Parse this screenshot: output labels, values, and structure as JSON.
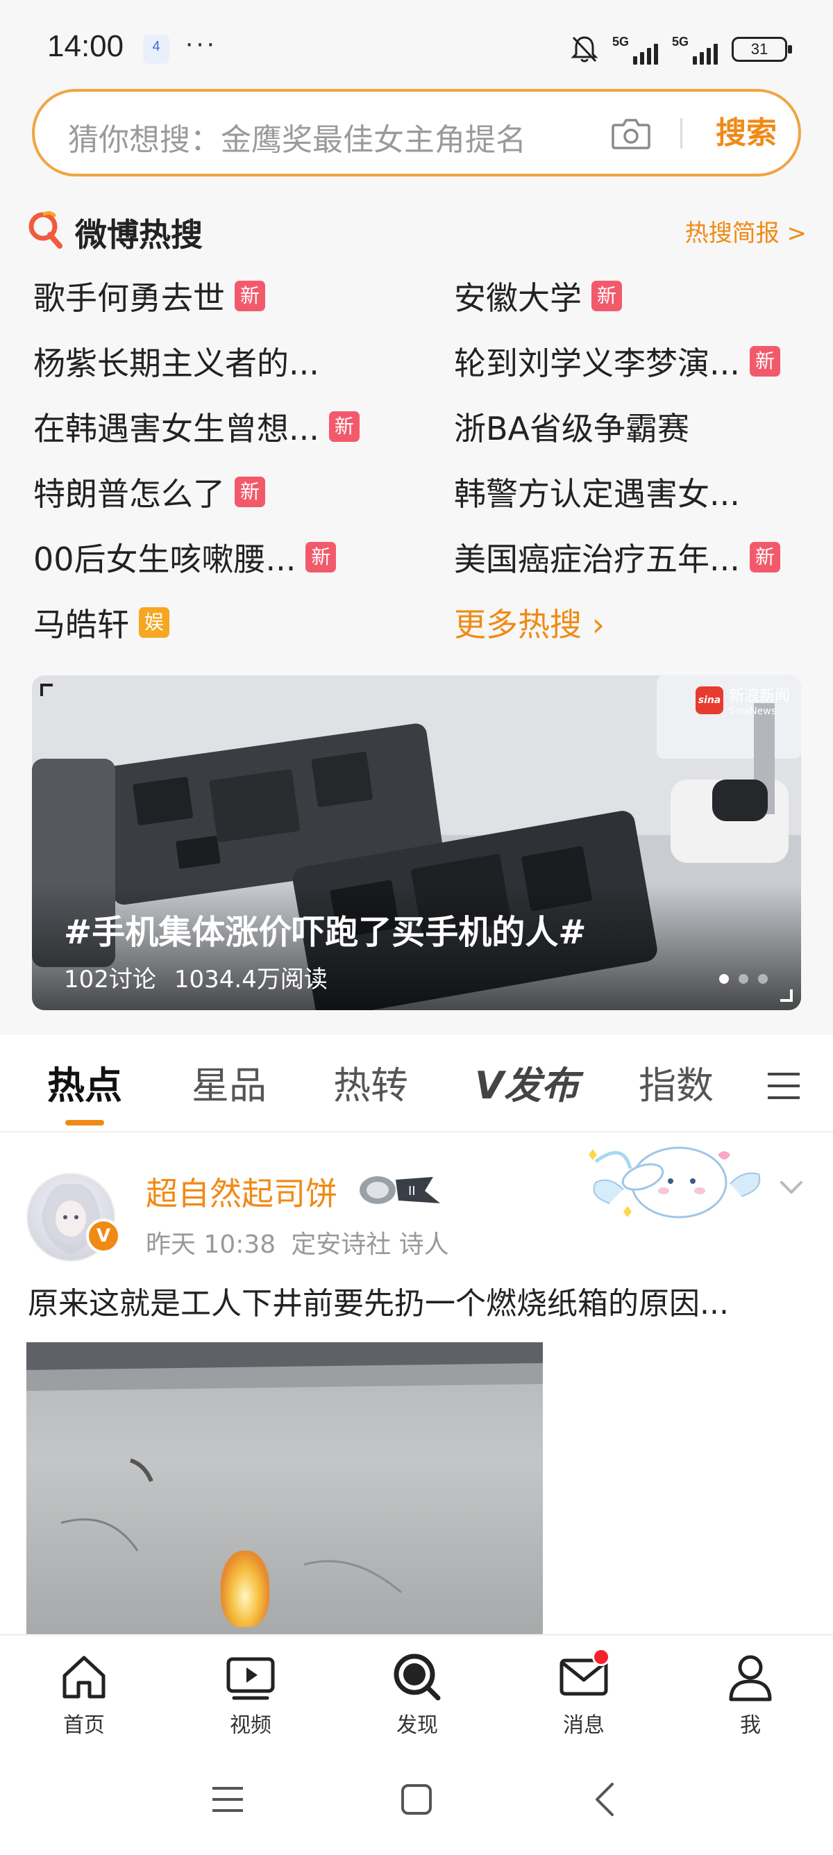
{
  "status_bar": {
    "time": "14:00",
    "notification_badge": "4",
    "more": "···",
    "network_1": "5G",
    "network_2": "5G",
    "battery": "31"
  },
  "search": {
    "placeholder": "猜你想搜：金鹰奖最佳女主角提名",
    "button_label": "搜索"
  },
  "hot_search": {
    "title": "微博热搜",
    "report_link": "热搜简报 >",
    "items": [
      {
        "text": "歌手何勇去世",
        "badge": "新"
      },
      {
        "text": "安徽大学",
        "badge": "新"
      },
      {
        "text": "杨紫长期主义者的...",
        "badge": ""
      },
      {
        "text": "轮到刘学义李梦演...",
        "badge": "新"
      },
      {
        "text": "在韩遇害女生曾想...",
        "badge": "新"
      },
      {
        "text": "浙BA省级争霸赛",
        "badge": ""
      },
      {
        "text": "特朗普怎么了",
        "badge": "新"
      },
      {
        "text": "韩警方认定遇害女...",
        "badge": ""
      },
      {
        "text": "00后女生咳嗽腰...",
        "badge": "新"
      },
      {
        "text": "美国癌症治疗五年...",
        "badge": "新"
      },
      {
        "text": "马皓轩",
        "badge": "娱"
      }
    ],
    "more_label": "更多热搜 ›"
  },
  "banner": {
    "title": "#手机集体涨价吓跑了买手机的人#",
    "discussions": "102讨论",
    "reads": "1034.4万阅读",
    "source_name": "新浪新闻",
    "source_sub": "SinaNews",
    "source_logo": "sina"
  },
  "tabs": [
    "热点",
    "星品",
    "热转",
    "V发布",
    "指数"
  ],
  "post": {
    "author": "超自然起司饼",
    "verified_mark": "V",
    "time": "昨天 10:38",
    "source": "定安诗社 诗人",
    "text": "原来这就是工人下井前要先扔一个燃烧纸箱的原因..."
  },
  "bottom_nav": [
    {
      "label": "首页",
      "icon": "home-icon"
    },
    {
      "label": "视频",
      "icon": "video-icon"
    },
    {
      "label": "发现",
      "icon": "discover-icon"
    },
    {
      "label": "消息",
      "icon": "mail-icon"
    },
    {
      "label": "我",
      "icon": "profile-icon"
    }
  ],
  "colors": {
    "accent": "#f08a15",
    "badge_new": "#f25a6c",
    "badge_ent": "#f5a623",
    "notification_dot": "#f5222d"
  }
}
